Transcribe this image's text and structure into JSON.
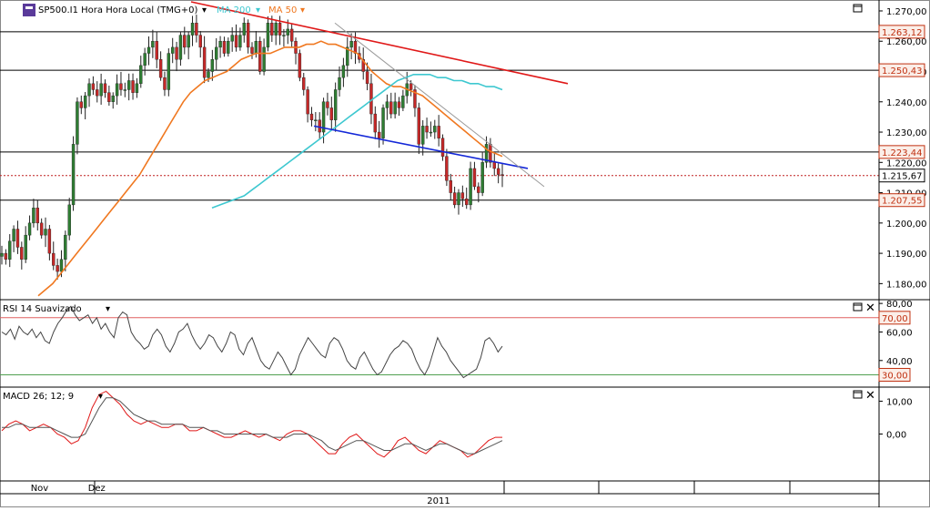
{
  "chart_data": [
    {
      "type": "candlestick",
      "title": "SP500.I1 Hora Hora Local (TMG+0)",
      "indicators": [
        {
          "name": "MA 200",
          "color": "#3ec8d0"
        },
        {
          "name": "MA 50",
          "color": "#f07820"
        }
      ],
      "ylim": [
        1175,
        1273
      ],
      "yticks": [
        "1.270,00",
        "1.260,00",
        "1.250,00",
        "1.240,00",
        "1.230,00",
        "1.220,00",
        "1.210,00",
        "1.200,00",
        "1.190,00",
        "1.180,00"
      ],
      "tick_values": [
        1270,
        1260,
        1250,
        1240,
        1230,
        1220,
        1210,
        1200,
        1190,
        1180
      ],
      "price_tags": [
        {
          "label": "1.263,12",
          "value": 1263.12,
          "style": "resistance"
        },
        {
          "label": "1.250,43",
          "value": 1250.43,
          "style": "resistance"
        },
        {
          "label": "1.223,44",
          "value": 1223.44,
          "style": "resistance"
        },
        {
          "label": "1.215,67",
          "value": 1215.67,
          "style": "current"
        },
        {
          "label": "1.207,55",
          "value": 1207.55,
          "style": "resistance"
        }
      ],
      "close_path": [
        1190,
        1188,
        1194,
        1198,
        1192,
        1188,
        1196,
        1200,
        1205,
        1200,
        1196,
        1198,
        1190,
        1186,
        1184,
        1188,
        1196,
        1206,
        1226,
        1240,
        1238,
        1242,
        1246,
        1244,
        1242,
        1246,
        1243,
        1240,
        1242,
        1246,
        1244,
        1244,
        1247,
        1243,
        1246,
        1252,
        1256,
        1258,
        1260,
        1254,
        1248,
        1244,
        1256,
        1258,
        1254,
        1262,
        1258,
        1262,
        1266,
        1262,
        1258,
        1248,
        1250,
        1254,
        1258,
        1260,
        1256,
        1260,
        1262,
        1258,
        1262,
        1266,
        1258,
        1256,
        1260,
        1250,
        1258,
        1266,
        1262,
        1266,
        1262,
        1262,
        1264,
        1260,
        1256,
        1248,
        1244,
        1236,
        1234,
        1234,
        1230,
        1240,
        1238,
        1234,
        1244,
        1248,
        1252,
        1258,
        1260,
        1256,
        1254,
        1250,
        1246,
        1236,
        1230,
        1228,
        1238,
        1240,
        1236,
        1240,
        1238,
        1242,
        1246,
        1244,
        1238,
        1226,
        1232,
        1230,
        1230,
        1232,
        1228,
        1222,
        1214,
        1210,
        1206,
        1210,
        1208,
        1206,
        1218,
        1212,
        1210,
        1220,
        1226,
        1220,
        1218,
        1216,
        1215.7
      ],
      "ma50": [
        1176,
        1178,
        1180,
        1183,
        1186,
        1189,
        1192,
        1195,
        1198,
        1201,
        1204,
        1207,
        1210,
        1213,
        1216,
        1220,
        1224,
        1228,
        1232,
        1236,
        1240,
        1243,
        1245,
        1247,
        1248,
        1249,
        1250,
        1252,
        1254,
        1255,
        1256,
        1256,
        1256,
        1257,
        1258,
        1258,
        1258,
        1259,
        1259,
        1260,
        1259,
        1259,
        1258,
        1257,
        1256,
        1253,
        1250,
        1248,
        1246,
        1245,
        1245,
        1244,
        1243,
        1242,
        1240,
        1238,
        1236,
        1234,
        1232,
        1230,
        1228,
        1226,
        1224,
        1223,
        1222
      ],
      "ma200": [
        1205,
        1206,
        1207,
        1208,
        1209,
        1211,
        1213,
        1215,
        1217,
        1219,
        1221,
        1223,
        1225,
        1227,
        1229,
        1231,
        1233,
        1235,
        1237,
        1239,
        1241,
        1243,
        1245,
        1247,
        1248,
        1249,
        1249,
        1249,
        1248,
        1248,
        1247,
        1247,
        1246,
        1246,
        1245,
        1245,
        1244
      ],
      "trendlines": [
        {
          "name": "upper resistance",
          "color": "#e01818",
          "from": [
            0,
            1273
          ],
          "to": [
            1,
            1246
          ]
        },
        {
          "name": "lower support",
          "color": "#1428d8",
          "from": [
            0,
            1232
          ],
          "to": [
            1,
            1218
          ]
        },
        {
          "name": "gray trend",
          "color": "#9a9a9a",
          "from": [
            0,
            1266
          ],
          "to": [
            1,
            1212
          ]
        }
      ]
    },
    {
      "type": "line",
      "title": "RSI 14 Suavizado",
      "ylim": [
        22,
        82
      ],
      "yticks": [
        "80,00",
        "60,00",
        "40,00"
      ],
      "tick_values": [
        80,
        60,
        40
      ],
      "levels": [
        {
          "label": "70,00",
          "value": 70,
          "color": "#e06060"
        },
        {
          "label": "30,00",
          "value": 30,
          "color": "#50a050"
        }
      ],
      "values": [
        60,
        58,
        62,
        55,
        64,
        60,
        58,
        62,
        56,
        60,
        54,
        52,
        60,
        66,
        70,
        75,
        78,
        72,
        68,
        70,
        72,
        66,
        70,
        62,
        66,
        60,
        56,
        70,
        74,
        72,
        60,
        55,
        52,
        48,
        50,
        58,
        62,
        58,
        50,
        46,
        52,
        60,
        62,
        66,
        58,
        52,
        48,
        52,
        58,
        56,
        50,
        46,
        52,
        60,
        58,
        48,
        44,
        52,
        56,
        48,
        40,
        36,
        34,
        40,
        46,
        42,
        36,
        30,
        34,
        44,
        50,
        56,
        52,
        48,
        44,
        42,
        52,
        56,
        54,
        48,
        40,
        36,
        34,
        42,
        46,
        40,
        34,
        30,
        32,
        38,
        44,
        48,
        50,
        54,
        52,
        48,
        40,
        34,
        30,
        36,
        46,
        56,
        50,
        46,
        40,
        36,
        32,
        28,
        30,
        32,
        34,
        42,
        54,
        56,
        52,
        46,
        50
      ]
    },
    {
      "type": "line",
      "title": "MACD 26; 12; 9",
      "ylim": [
        -14,
        14
      ],
      "yticks": [
        "10,00",
        "0,00"
      ],
      "tick_values": [
        10,
        0
      ],
      "series": [
        {
          "name": "MACD",
          "color": "#e01818",
          "values": [
            1,
            3,
            4,
            3,
            1,
            2,
            3,
            2,
            0,
            -1,
            -3,
            -2,
            2,
            8,
            12,
            13,
            11,
            9,
            6,
            4,
            3,
            4,
            3,
            2,
            2,
            3,
            3,
            1,
            1,
            2,
            1,
            0,
            -1,
            -1,
            0,
            1,
            0,
            -1,
            0,
            -1,
            -2,
            0,
            1,
            1,
            0,
            -2,
            -4,
            -6,
            -6,
            -3,
            -1,
            0,
            -2,
            -4,
            -6,
            -7,
            -5,
            -2,
            -1,
            -3,
            -5,
            -6,
            -4,
            -2,
            -3,
            -4,
            -5,
            -7,
            -6,
            -4,
            -2,
            -1,
            -1
          ]
        },
        {
          "name": "Signal",
          "color": "#555555",
          "values": [
            2,
            2,
            3,
            3,
            2,
            2,
            2,
            2,
            1,
            0,
            -1,
            -1,
            0,
            4,
            8,
            11,
            11,
            10,
            8,
            6,
            5,
            4,
            4,
            3,
            3,
            3,
            3,
            2,
            2,
            2,
            1,
            1,
            0,
            0,
            0,
            0,
            0,
            0,
            0,
            -1,
            -1,
            -1,
            0,
            0,
            0,
            -1,
            -2,
            -4,
            -5,
            -4,
            -3,
            -2,
            -2,
            -3,
            -4,
            -5,
            -5,
            -4,
            -3,
            -3,
            -4,
            -5,
            -4,
            -3,
            -3,
            -4,
            -5,
            -6,
            -6,
            -5,
            -4,
            -3,
            -2
          ]
        }
      ]
    }
  ],
  "x_axis": {
    "months": [
      {
        "label": "Nov",
        "pos": 0.045
      },
      {
        "label": "Dez",
        "pos": 0.11
      }
    ],
    "year": "2011"
  },
  "colors": {
    "resistance_tag": "#c03010",
    "current_tag": "#000000",
    "grid": "#000000",
    "up_candle": "#2e7d32",
    "down_candle": "#c62828"
  }
}
